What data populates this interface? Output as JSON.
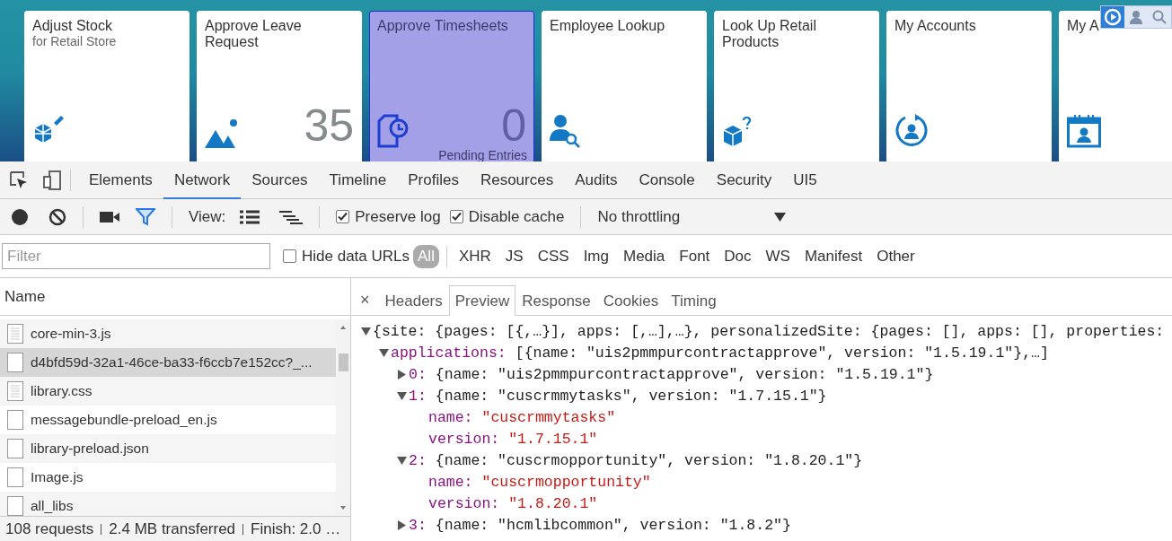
{
  "launchpad": {
    "tiles": [
      {
        "title": "Adjust Stock",
        "subtitle": "for Retail Store",
        "selected": false
      },
      {
        "title": "Approve Leave Request",
        "number": "35",
        "selected": false
      },
      {
        "title": "Approve Timesheets",
        "number": "0",
        "footer": "Pending Entries",
        "selected": true
      },
      {
        "title": "Employee Lookup",
        "selected": false
      },
      {
        "title": "Look Up Retail Products",
        "selected": false
      },
      {
        "title": "My Accounts",
        "selected": false
      },
      {
        "title": "My A",
        "selected": false
      }
    ]
  },
  "devtools": {
    "panel_tabs": [
      {
        "label": "Elements",
        "selected": false
      },
      {
        "label": "Network",
        "selected": true
      },
      {
        "label": "Sources",
        "selected": false
      },
      {
        "label": "Timeline",
        "selected": false
      },
      {
        "label": "Profiles",
        "selected": false
      },
      {
        "label": "Resources",
        "selected": false
      },
      {
        "label": "Audits",
        "selected": false
      },
      {
        "label": "Console",
        "selected": false
      },
      {
        "label": "Security",
        "selected": false
      },
      {
        "label": "UI5",
        "selected": false
      }
    ],
    "toolbar": {
      "filter_on": true,
      "view_label": "View:",
      "preserve_log": {
        "label": "Preserve log",
        "checked": true
      },
      "disable_cache": {
        "label": "Disable cache",
        "checked": true
      },
      "throttling": "No throttling"
    },
    "filter_bar": {
      "placeholder": "Filter",
      "hide_data_urls": {
        "label": "Hide data URLs",
        "checked": false
      },
      "types": [
        {
          "label": "All",
          "selected": true
        },
        {
          "label": "XHR",
          "selected": false
        },
        {
          "label": "JS",
          "selected": false
        },
        {
          "label": "CSS",
          "selected": false
        },
        {
          "label": "Img",
          "selected": false
        },
        {
          "label": "Media",
          "selected": false
        },
        {
          "label": "Font",
          "selected": false
        },
        {
          "label": "Doc",
          "selected": false
        },
        {
          "label": "WS",
          "selected": false
        },
        {
          "label": "Manifest",
          "selected": false
        },
        {
          "label": "Other",
          "selected": false
        }
      ]
    },
    "requests": {
      "column": "Name",
      "rows": [
        {
          "name": "core-min-3.js",
          "kind": "text",
          "selected": false
        },
        {
          "name": "d4bfd59d-32a1-46ce-ba33-f6ccb7e152cc?_...",
          "kind": "blank",
          "selected": true
        },
        {
          "name": "library.css",
          "kind": "text",
          "selected": false
        },
        {
          "name": "messagebundle-preload_en.js",
          "kind": "blank",
          "selected": false
        },
        {
          "name": "library-preload.json",
          "kind": "blank",
          "selected": false
        },
        {
          "name": "Image.js",
          "kind": "blank",
          "selected": false
        },
        {
          "name": "all_libs",
          "kind": "blank",
          "selected": false
        }
      ],
      "status": [
        "108 requests",
        "2.4 MB transferred",
        "Finish: 2.0 …"
      ]
    },
    "detail_close": "×",
    "detail_tabs": [
      {
        "label": "Headers",
        "selected": false
      },
      {
        "label": "Preview",
        "selected": true
      },
      {
        "label": "Response",
        "selected": false
      },
      {
        "label": "Cookies",
        "selected": false
      },
      {
        "label": "Timing",
        "selected": false
      }
    ],
    "preview_tree": {
      "kind": "node",
      "expanded": true,
      "text": "{site: {pages: [{,…}], apps: [,…],…}, personalizedSite: {pages: [], apps: [], properties:",
      "children": [
        {
          "kind": "node",
          "key": "applications:",
          "expanded": true,
          "text": "[{name: \"uis2pmmpurcontractapprove\", version: \"1.5.19.1\"},…]",
          "children": [
            {
              "kind": "node",
              "key": "0:",
              "expanded": false,
              "text": "{name: \"uis2pmmpurcontractapprove\", version: \"1.5.19.1\"}"
            },
            {
              "kind": "node",
              "key": "1:",
              "expanded": true,
              "text": "{name: \"cuscrmmytasks\", version: \"1.7.15.1\"}",
              "children": [
                {
                  "kind": "property",
                  "key": "name:",
                  "value": "\"cuscrmmytasks\""
                },
                {
                  "kind": "property",
                  "key": "version:",
                  "value": "\"1.7.15.1\""
                }
              ]
            },
            {
              "kind": "node",
              "key": "2:",
              "expanded": true,
              "text": "{name: \"cuscrmopportunity\", version: \"1.8.20.1\"}",
              "children": [
                {
                  "kind": "property",
                  "key": "name:",
                  "value": "\"cuscrmopportunity\""
                },
                {
                  "kind": "property",
                  "key": "version:",
                  "value": "\"1.8.20.1\""
                }
              ]
            },
            {
              "kind": "node",
              "key": "3:",
              "expanded": false,
              "text": "{name: \"hcmlibcommon\", version: \"1.8.2\"}"
            }
          ]
        }
      ]
    }
  }
}
